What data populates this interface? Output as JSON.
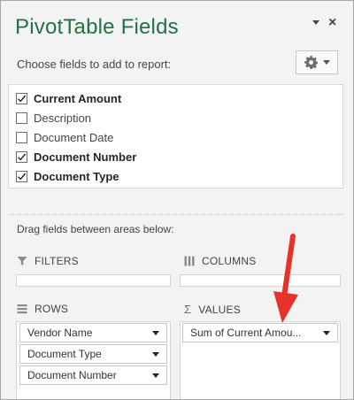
{
  "pane": {
    "title": "PivotTable Fields",
    "close_glyph": "×",
    "subtitle": "Choose fields to add to report:",
    "gear_icon": "gear-icon",
    "accent_color": "#217346"
  },
  "fields": [
    {
      "label": "Current Amount",
      "checked": true
    },
    {
      "label": "Description",
      "checked": false
    },
    {
      "label": "Document Date",
      "checked": false
    },
    {
      "label": "Document Number",
      "checked": true
    },
    {
      "label": "Document Type",
      "checked": true
    }
  ],
  "areas": {
    "drag_label": "Drag fields between areas below:",
    "filters": {
      "label": "FILTERS",
      "icon": "filter-icon",
      "items": []
    },
    "columns": {
      "label": "COLUMNS",
      "icon": "columns-icon",
      "items": []
    },
    "rows": {
      "label": "ROWS",
      "icon": "rows-icon",
      "items": [
        "Vendor Name",
        "Document Type",
        "Document Number"
      ]
    },
    "values": {
      "label": "VALUES",
      "icon": "sigma-icon",
      "symbol": "Σ",
      "items": [
        "Sum of Current Amou..."
      ]
    }
  },
  "annotation": {
    "arrow_color": "#e8312a"
  }
}
